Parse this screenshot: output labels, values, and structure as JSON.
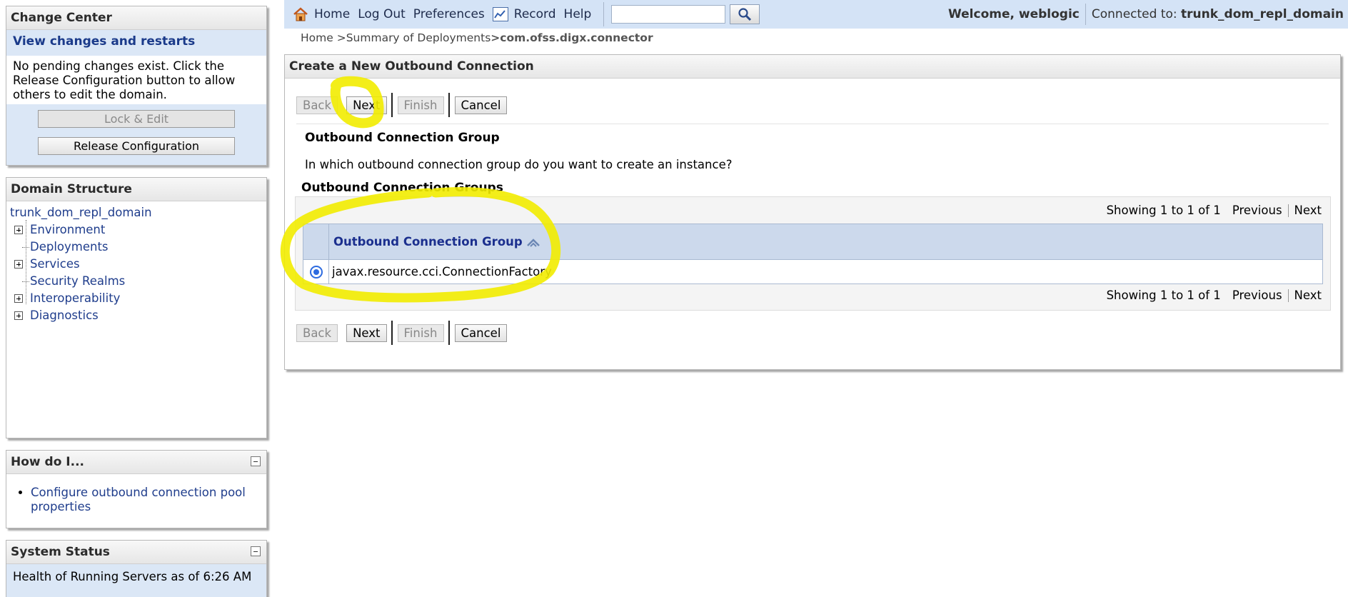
{
  "change_center": {
    "title": "Change Center",
    "subtitle": "View changes and restarts",
    "message": "No pending changes exist. Click the Release Configuration button to allow others to edit the domain.",
    "lock_edit_label": "Lock & Edit",
    "release_label": "Release Configuration"
  },
  "domain_structure": {
    "title": "Domain Structure",
    "root": "trunk_dom_repl_domain",
    "items": [
      {
        "label": "Environment",
        "expandable": true
      },
      {
        "label": "Deployments",
        "expandable": false
      },
      {
        "label": "Services",
        "expandable": true
      },
      {
        "label": "Security Realms",
        "expandable": false
      },
      {
        "label": "Interoperability",
        "expandable": true
      },
      {
        "label": "Diagnostics",
        "expandable": true
      }
    ]
  },
  "how_do_i": {
    "title": "How do I...",
    "links": [
      "Configure outbound connection pool properties"
    ]
  },
  "system_status": {
    "title": "System Status",
    "text": "Health of Running Servers as of  6:26 AM"
  },
  "topbar": {
    "home": "Home",
    "logout": "Log Out",
    "preferences": "Preferences",
    "record": "Record",
    "help": "Help",
    "search_value": "",
    "welcome_prefix": "Welcome, ",
    "user": "weblogic",
    "connected_prefix": "Connected to: ",
    "domain": "trunk_dom_repl_domain"
  },
  "breadcrumb": {
    "home": "Home",
    "summary": ">Summary of Deployments",
    "current": ">com.ofss.digx.connector"
  },
  "main": {
    "title": "Create a New Outbound Connection",
    "buttons": {
      "back": "Back",
      "next": "Next",
      "finish": "Finish",
      "cancel": "Cancel"
    },
    "section_title": "Outbound Connection Group",
    "question": "In which outbound connection group do you want to create an instance?",
    "table_title": "Outbound Connection Groups",
    "pager": {
      "showing": "Showing 1 to 1 of 1",
      "previous": "Previous",
      "next": "Next"
    },
    "column_header": "Outbound Connection Group",
    "rows": [
      {
        "group": "javax.resource.cci.ConnectionFactory",
        "selected": true
      }
    ]
  },
  "colors": {
    "highlight": "#f2ec00",
    "header_blue": "#d4e3f6",
    "link": "#1f3d8c"
  }
}
